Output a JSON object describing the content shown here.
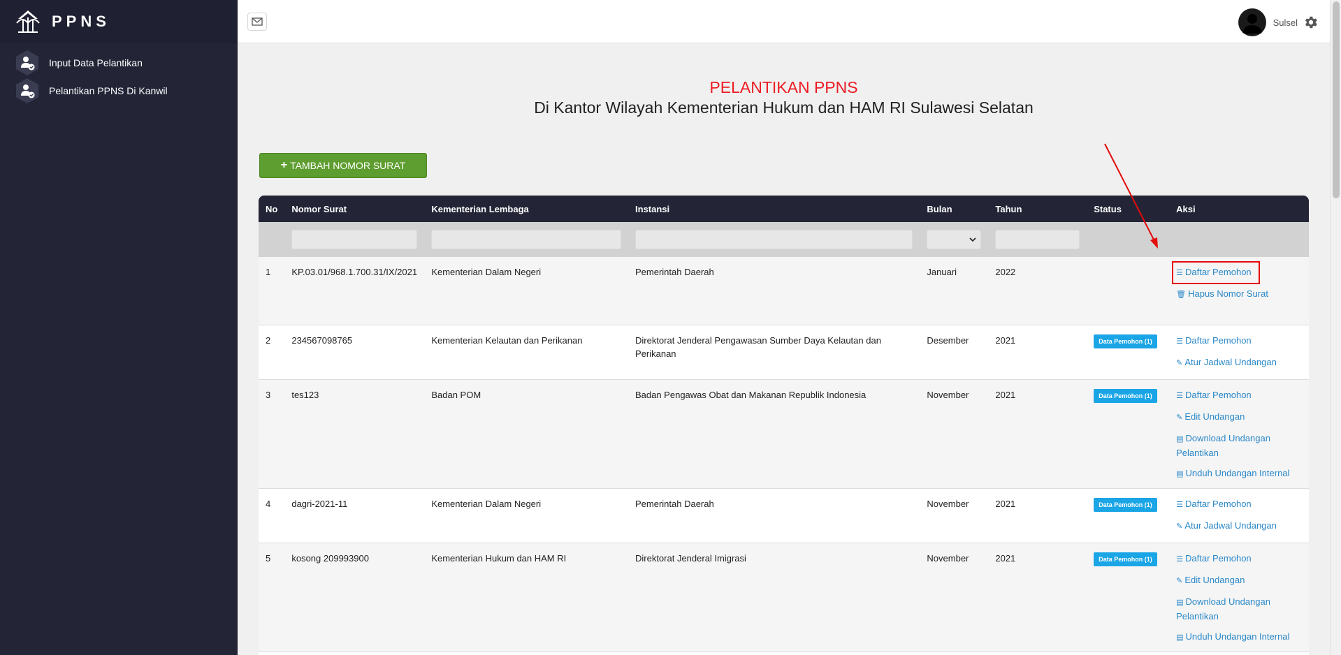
{
  "sidebar": {
    "brand": "PPNS",
    "items": [
      {
        "label": "Input Data Pelantikan"
      },
      {
        "label": "Pelantikan PPNS Di Kanwil"
      }
    ]
  },
  "topbar": {
    "user_name": "Sulsel"
  },
  "page": {
    "title": "PELANTIKAN PPNS",
    "subtitle": "Di Kantor Wilayah Kementerian Hukum dan HAM RI Sulawesi Selatan",
    "add_button": "TAMBAH NOMOR SURAT"
  },
  "table": {
    "headers": [
      "No",
      "Nomor Surat",
      "Kementerian Lembaga",
      "Instansi",
      "Bulan",
      "Tahun",
      "Status",
      "Aksi"
    ],
    "rows": [
      {
        "no": "1",
        "nomor": "KP.03.01/968.1.700.31/IX/2021",
        "kementerian": "Kementerian Dalam Negeri",
        "instansi": "Pemerintah Daerah",
        "bulan": "Januari",
        "tahun": "2022",
        "status": "",
        "actions": [
          "Daftar Pemohon",
          "Hapus Nomor Surat"
        ]
      },
      {
        "no": "2",
        "nomor": "234567098765",
        "kementerian": "Kementerian Kelautan dan Perikanan",
        "instansi": "Direktorat Jenderal Pengawasan Sumber Daya Kelautan dan Perikanan",
        "bulan": "Desember",
        "tahun": "2021",
        "status": "Data Pemohon (1)",
        "actions": [
          "Daftar Pemohon",
          "Atur Jadwal Undangan"
        ]
      },
      {
        "no": "3",
        "nomor": "tes123",
        "kementerian": "Badan POM",
        "instansi": "Badan Pengawas Obat dan Makanan Republik Indonesia",
        "bulan": "November",
        "tahun": "2021",
        "status": "Data Pemohon (1)",
        "actions": [
          "Daftar Pemohon",
          "Edit Undangan",
          "Download Undangan Pelantikan",
          "Unduh Undangan Internal"
        ]
      },
      {
        "no": "4",
        "nomor": "dagri-2021-11",
        "kementerian": "Kementerian Dalam Negeri",
        "instansi": "Pemerintah Daerah",
        "bulan": "November",
        "tahun": "2021",
        "status": "Data Pemohon (1)",
        "actions": [
          "Daftar Pemohon",
          "Atur Jadwal Undangan"
        ]
      },
      {
        "no": "5",
        "nomor": "kosong 209993900",
        "kementerian": "Kementerian Hukum dan HAM RI",
        "instansi": "Direktorat Jenderal Imigrasi",
        "bulan": "November",
        "tahun": "2021",
        "status": "Data Pemohon (1)",
        "actions": [
          "Daftar Pemohon",
          "Edit Undangan",
          "Download Undangan Pelantikan",
          "Unduh Undangan Internal"
        ]
      }
    ]
  },
  "colors": {
    "sidebar_bg": "#232537",
    "title_red": "#ec1c24",
    "add_green": "#5e9d2f",
    "badge_blue": "#1aa5e6",
    "link_blue": "#2a88c8",
    "annotation_red": "#e30b0b"
  },
  "icons": {
    "mail": "envelope-icon",
    "gear": "gear-icon",
    "list": "list-icon",
    "trash": "trash-icon",
    "pencil": "pencil-icon",
    "file": "file-icon"
  }
}
